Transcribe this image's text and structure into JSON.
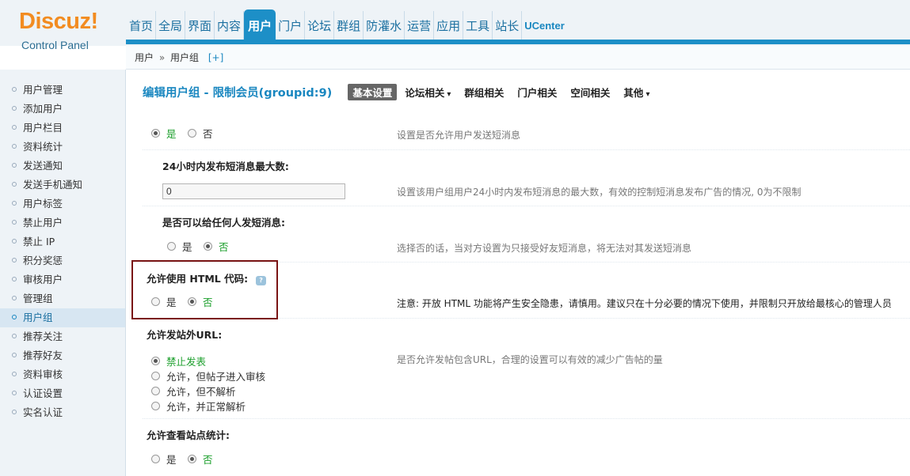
{
  "logo": {
    "brand": "Discuz!",
    "subtitle": "Control Panel"
  },
  "topnav": [
    "首页",
    "全局",
    "界面",
    "内容",
    "用户",
    "门户",
    "论坛",
    "群组",
    "防灌水",
    "运营",
    "应用",
    "工具",
    "站长",
    "UCenter"
  ],
  "breadcrumb": {
    "part1": "用户",
    "sep": "»",
    "part2": "用户组",
    "plus": "[+]"
  },
  "sidebar": [
    "用户管理",
    "添加用户",
    "用户栏目",
    "资料统计",
    "发送通知",
    "发送手机通知",
    "用户标签",
    "禁止用户",
    "禁止 IP",
    "积分奖惩",
    "审核用户",
    "管理组",
    "用户组",
    "推荐关注",
    "推荐好友",
    "资料审核",
    "认证设置",
    "实名认证"
  ],
  "main": {
    "title": "编辑用户组 - 限制会员(groupid:9)",
    "tabs": [
      "基本设置",
      "论坛相关",
      "群组相关",
      "门户相关",
      "空间相关",
      "其他"
    ],
    "caret": "▾",
    "r1": {
      "yes": "是",
      "no": "否",
      "note": "设置是否允许用户发送短消息"
    },
    "r2": {
      "label": "24小时内发布短消息最大数:",
      "value": "0",
      "note": "设置该用户组用户24小时内发布短消息的最大数，有效的控制短消息发布广告的情况, 0为不限制"
    },
    "r3": {
      "label": "是否可以给任何人发短消息:",
      "yes": "是",
      "no": "否",
      "note": "选择否的话，当对方设置为只接受好友短消息，将无法对其发送短消息"
    },
    "r4": {
      "label": "允许使用 HTML 代码:",
      "yes": "是",
      "no": "否",
      "note": "注意: 开放 HTML 功能将产生安全隐患，请慎用。建议只在十分必要的情况下使用，并限制只开放给最核心的管理人员"
    },
    "r5": {
      "label": "允许发站外URL:",
      "opt1": "禁止发表",
      "opt2": "允许，但帖子进入审核",
      "opt3": "允许，但不解析",
      "opt4": "允许，并正常解析",
      "note": "是否允许发帖包含URL，合理的设置可以有效的减少广告帖的量"
    },
    "r6": {
      "label": "允许查看站点统计:",
      "yes": "是",
      "no": "否"
    }
  }
}
